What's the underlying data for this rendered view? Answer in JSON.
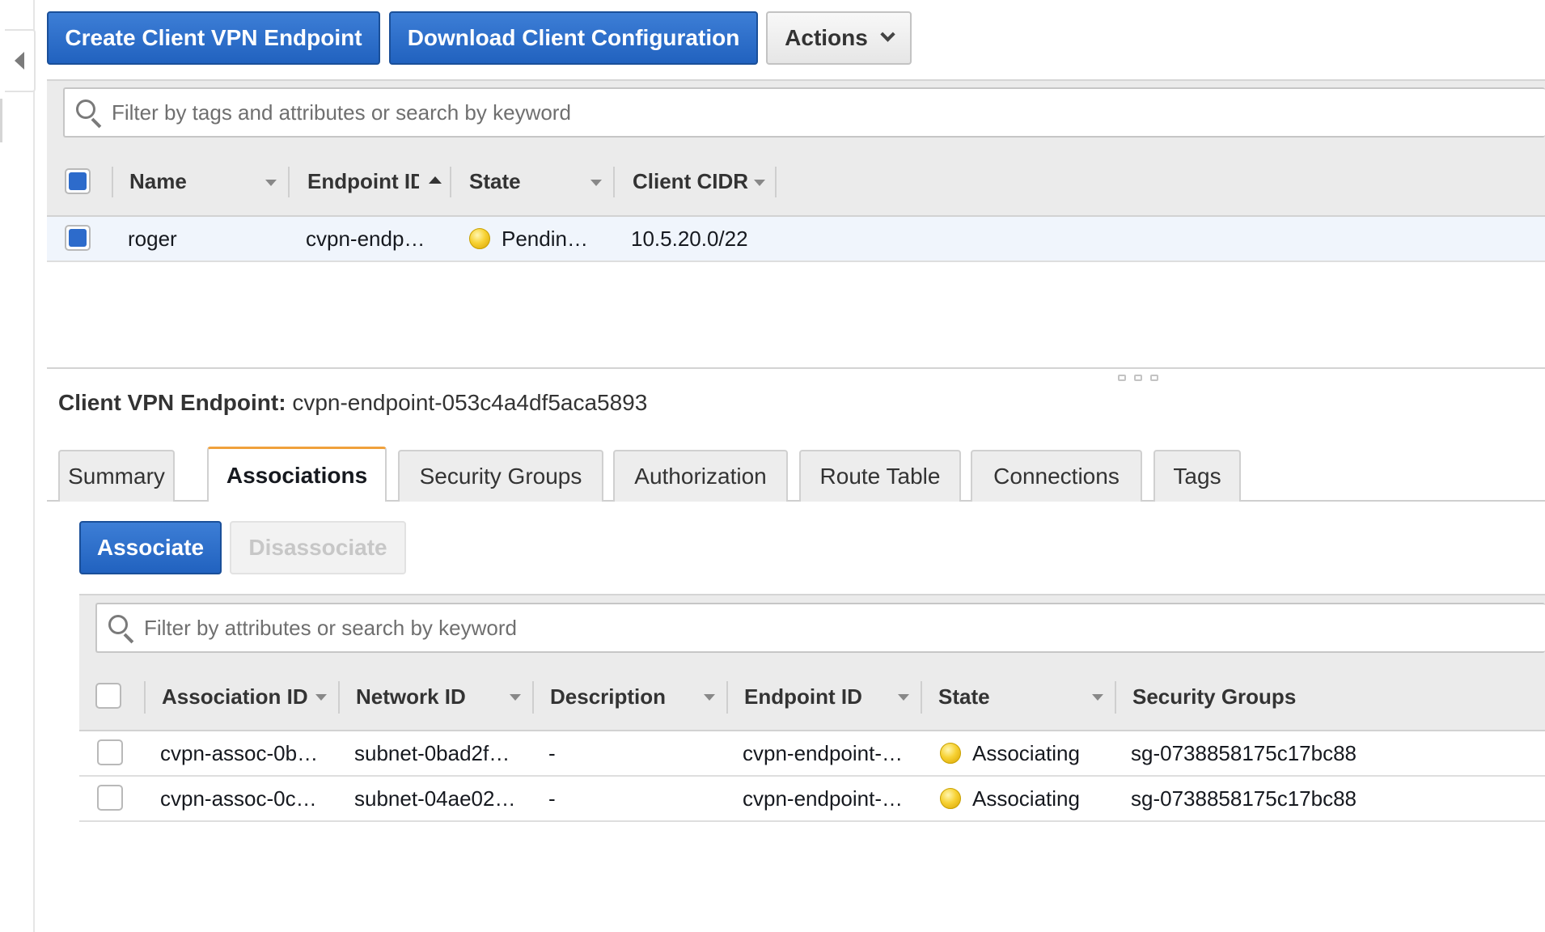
{
  "toolbar": {
    "create_label": "Create Client VPN Endpoint",
    "download_label": "Download Client Configuration",
    "actions_label": "Actions"
  },
  "top_filter": {
    "placeholder": "Filter by tags and attributes or search by keyword"
  },
  "endpoints_table": {
    "columns": [
      "Name",
      "Endpoint ID",
      "State",
      "Client CIDR"
    ],
    "rows": [
      {
        "name": "roger",
        "endpoint_id": "cvpn-endp…",
        "state": "Pendin…",
        "client_cidr": "10.5.20.0/22"
      }
    ]
  },
  "details": {
    "label": "Client VPN Endpoint:",
    "endpoint_id": "cvpn-endpoint-053c4a4df5aca5893",
    "tabs": [
      "Summary",
      "Associations",
      "Security Groups",
      "Authorization",
      "Route Table",
      "Connections",
      "Tags"
    ],
    "active_tab": "Associations"
  },
  "associations": {
    "associate_label": "Associate",
    "disassociate_label": "Disassociate",
    "filter_placeholder": "Filter by attributes or search by keyword",
    "columns": [
      "Association ID",
      "Network ID",
      "Description",
      "Endpoint ID",
      "State",
      "Security Groups"
    ],
    "rows": [
      {
        "association_id": "cvpn-assoc-0b…",
        "network_id": "subnet-0bad2f…",
        "description": "-",
        "endpoint_id": "cvpn-endpoint-…",
        "state": "Associating",
        "security_groups": "sg-0738858175c17bc88"
      },
      {
        "association_id": "cvpn-assoc-0c…",
        "network_id": "subnet-04ae02…",
        "description": "-",
        "endpoint_id": "cvpn-endpoint-…",
        "state": "Associating",
        "security_groups": "sg-0738858175c17bc88"
      }
    ]
  },
  "colors": {
    "primary": "#2a6fcf",
    "pending": "#f5cc2a",
    "active_tab_accent": "#f0a13c"
  }
}
